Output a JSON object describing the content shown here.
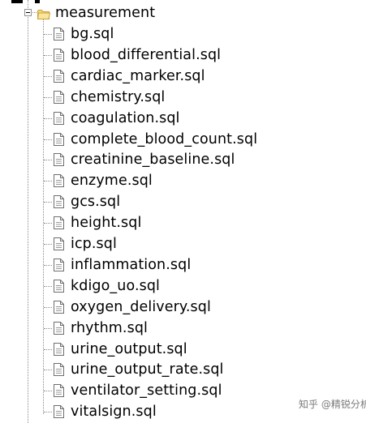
{
  "folder": {
    "label": "measurement",
    "icon": "folder-open-icon",
    "expander_icon": "collapse-minus-icon"
  },
  "files": [
    {
      "label": "bg.sql",
      "icon": "sql-file-icon"
    },
    {
      "label": "blood_differential.sql",
      "icon": "sql-file-icon"
    },
    {
      "label": "cardiac_marker.sql",
      "icon": "sql-file-icon"
    },
    {
      "label": "chemistry.sql",
      "icon": "sql-file-icon"
    },
    {
      "label": "coagulation.sql",
      "icon": "sql-file-icon"
    },
    {
      "label": "complete_blood_count.sql",
      "icon": "sql-file-icon"
    },
    {
      "label": "creatinine_baseline.sql",
      "icon": "sql-file-icon"
    },
    {
      "label": "enzyme.sql",
      "icon": "sql-file-icon"
    },
    {
      "label": "gcs.sql",
      "icon": "sql-file-icon"
    },
    {
      "label": "height.sql",
      "icon": "sql-file-icon"
    },
    {
      "label": "icp.sql",
      "icon": "sql-file-icon"
    },
    {
      "label": "inflammation.sql",
      "icon": "sql-file-icon"
    },
    {
      "label": "kdigo_uo.sql",
      "icon": "sql-file-icon"
    },
    {
      "label": "oxygen_delivery.sql",
      "icon": "sql-file-icon"
    },
    {
      "label": "rhythm.sql",
      "icon": "sql-file-icon"
    },
    {
      "label": "urine_output.sql",
      "icon": "sql-file-icon"
    },
    {
      "label": "urine_output_rate.sql",
      "icon": "sql-file-icon"
    },
    {
      "label": "ventilator_setting.sql",
      "icon": "sql-file-icon"
    },
    {
      "label": "vitalsign.sql",
      "icon": "sql-file-icon"
    }
  ],
  "watermark": "知乎 @精锐分析",
  "colors": {
    "guide_line": "#8a8a8a",
    "folder_fill": "#f5d77a",
    "folder_edge": "#c9a23a",
    "file_edge": "#6e6e6e",
    "text": "#000000"
  }
}
